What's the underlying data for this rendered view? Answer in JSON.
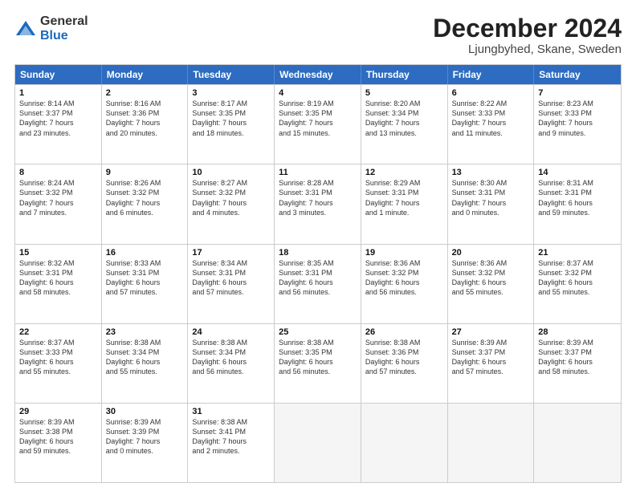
{
  "logo": {
    "general": "General",
    "blue": "Blue"
  },
  "header": {
    "month": "December 2024",
    "location": "Ljungbyhed, Skane, Sweden"
  },
  "weekdays": [
    "Sunday",
    "Monday",
    "Tuesday",
    "Wednesday",
    "Thursday",
    "Friday",
    "Saturday"
  ],
  "rows": [
    [
      {
        "day": "1",
        "info": "Sunrise: 8:14 AM\nSunset: 3:37 PM\nDaylight: 7 hours\nand 23 minutes."
      },
      {
        "day": "2",
        "info": "Sunrise: 8:16 AM\nSunset: 3:36 PM\nDaylight: 7 hours\nand 20 minutes."
      },
      {
        "day": "3",
        "info": "Sunrise: 8:17 AM\nSunset: 3:35 PM\nDaylight: 7 hours\nand 18 minutes."
      },
      {
        "day": "4",
        "info": "Sunrise: 8:19 AM\nSunset: 3:35 PM\nDaylight: 7 hours\nand 15 minutes."
      },
      {
        "day": "5",
        "info": "Sunrise: 8:20 AM\nSunset: 3:34 PM\nDaylight: 7 hours\nand 13 minutes."
      },
      {
        "day": "6",
        "info": "Sunrise: 8:22 AM\nSunset: 3:33 PM\nDaylight: 7 hours\nand 11 minutes."
      },
      {
        "day": "7",
        "info": "Sunrise: 8:23 AM\nSunset: 3:33 PM\nDaylight: 7 hours\nand 9 minutes."
      }
    ],
    [
      {
        "day": "8",
        "info": "Sunrise: 8:24 AM\nSunset: 3:32 PM\nDaylight: 7 hours\nand 7 minutes."
      },
      {
        "day": "9",
        "info": "Sunrise: 8:26 AM\nSunset: 3:32 PM\nDaylight: 7 hours\nand 6 minutes."
      },
      {
        "day": "10",
        "info": "Sunrise: 8:27 AM\nSunset: 3:32 PM\nDaylight: 7 hours\nand 4 minutes."
      },
      {
        "day": "11",
        "info": "Sunrise: 8:28 AM\nSunset: 3:31 PM\nDaylight: 7 hours\nand 3 minutes."
      },
      {
        "day": "12",
        "info": "Sunrise: 8:29 AM\nSunset: 3:31 PM\nDaylight: 7 hours\nand 1 minute."
      },
      {
        "day": "13",
        "info": "Sunrise: 8:30 AM\nSunset: 3:31 PM\nDaylight: 7 hours\nand 0 minutes."
      },
      {
        "day": "14",
        "info": "Sunrise: 8:31 AM\nSunset: 3:31 PM\nDaylight: 6 hours\nand 59 minutes."
      }
    ],
    [
      {
        "day": "15",
        "info": "Sunrise: 8:32 AM\nSunset: 3:31 PM\nDaylight: 6 hours\nand 58 minutes."
      },
      {
        "day": "16",
        "info": "Sunrise: 8:33 AM\nSunset: 3:31 PM\nDaylight: 6 hours\nand 57 minutes."
      },
      {
        "day": "17",
        "info": "Sunrise: 8:34 AM\nSunset: 3:31 PM\nDaylight: 6 hours\nand 57 minutes."
      },
      {
        "day": "18",
        "info": "Sunrise: 8:35 AM\nSunset: 3:31 PM\nDaylight: 6 hours\nand 56 minutes."
      },
      {
        "day": "19",
        "info": "Sunrise: 8:36 AM\nSunset: 3:32 PM\nDaylight: 6 hours\nand 56 minutes."
      },
      {
        "day": "20",
        "info": "Sunrise: 8:36 AM\nSunset: 3:32 PM\nDaylight: 6 hours\nand 55 minutes."
      },
      {
        "day": "21",
        "info": "Sunrise: 8:37 AM\nSunset: 3:32 PM\nDaylight: 6 hours\nand 55 minutes."
      }
    ],
    [
      {
        "day": "22",
        "info": "Sunrise: 8:37 AM\nSunset: 3:33 PM\nDaylight: 6 hours\nand 55 minutes."
      },
      {
        "day": "23",
        "info": "Sunrise: 8:38 AM\nSunset: 3:34 PM\nDaylight: 6 hours\nand 55 minutes."
      },
      {
        "day": "24",
        "info": "Sunrise: 8:38 AM\nSunset: 3:34 PM\nDaylight: 6 hours\nand 56 minutes."
      },
      {
        "day": "25",
        "info": "Sunrise: 8:38 AM\nSunset: 3:35 PM\nDaylight: 6 hours\nand 56 minutes."
      },
      {
        "day": "26",
        "info": "Sunrise: 8:38 AM\nSunset: 3:36 PM\nDaylight: 6 hours\nand 57 minutes."
      },
      {
        "day": "27",
        "info": "Sunrise: 8:39 AM\nSunset: 3:37 PM\nDaylight: 6 hours\nand 57 minutes."
      },
      {
        "day": "28",
        "info": "Sunrise: 8:39 AM\nSunset: 3:37 PM\nDaylight: 6 hours\nand 58 minutes."
      }
    ],
    [
      {
        "day": "29",
        "info": "Sunrise: 8:39 AM\nSunset: 3:38 PM\nDaylight: 6 hours\nand 59 minutes."
      },
      {
        "day": "30",
        "info": "Sunrise: 8:39 AM\nSunset: 3:39 PM\nDaylight: 7 hours\nand 0 minutes."
      },
      {
        "day": "31",
        "info": "Sunrise: 8:38 AM\nSunset: 3:41 PM\nDaylight: 7 hours\nand 2 minutes."
      },
      {
        "day": "",
        "info": ""
      },
      {
        "day": "",
        "info": ""
      },
      {
        "day": "",
        "info": ""
      },
      {
        "day": "",
        "info": ""
      }
    ]
  ]
}
